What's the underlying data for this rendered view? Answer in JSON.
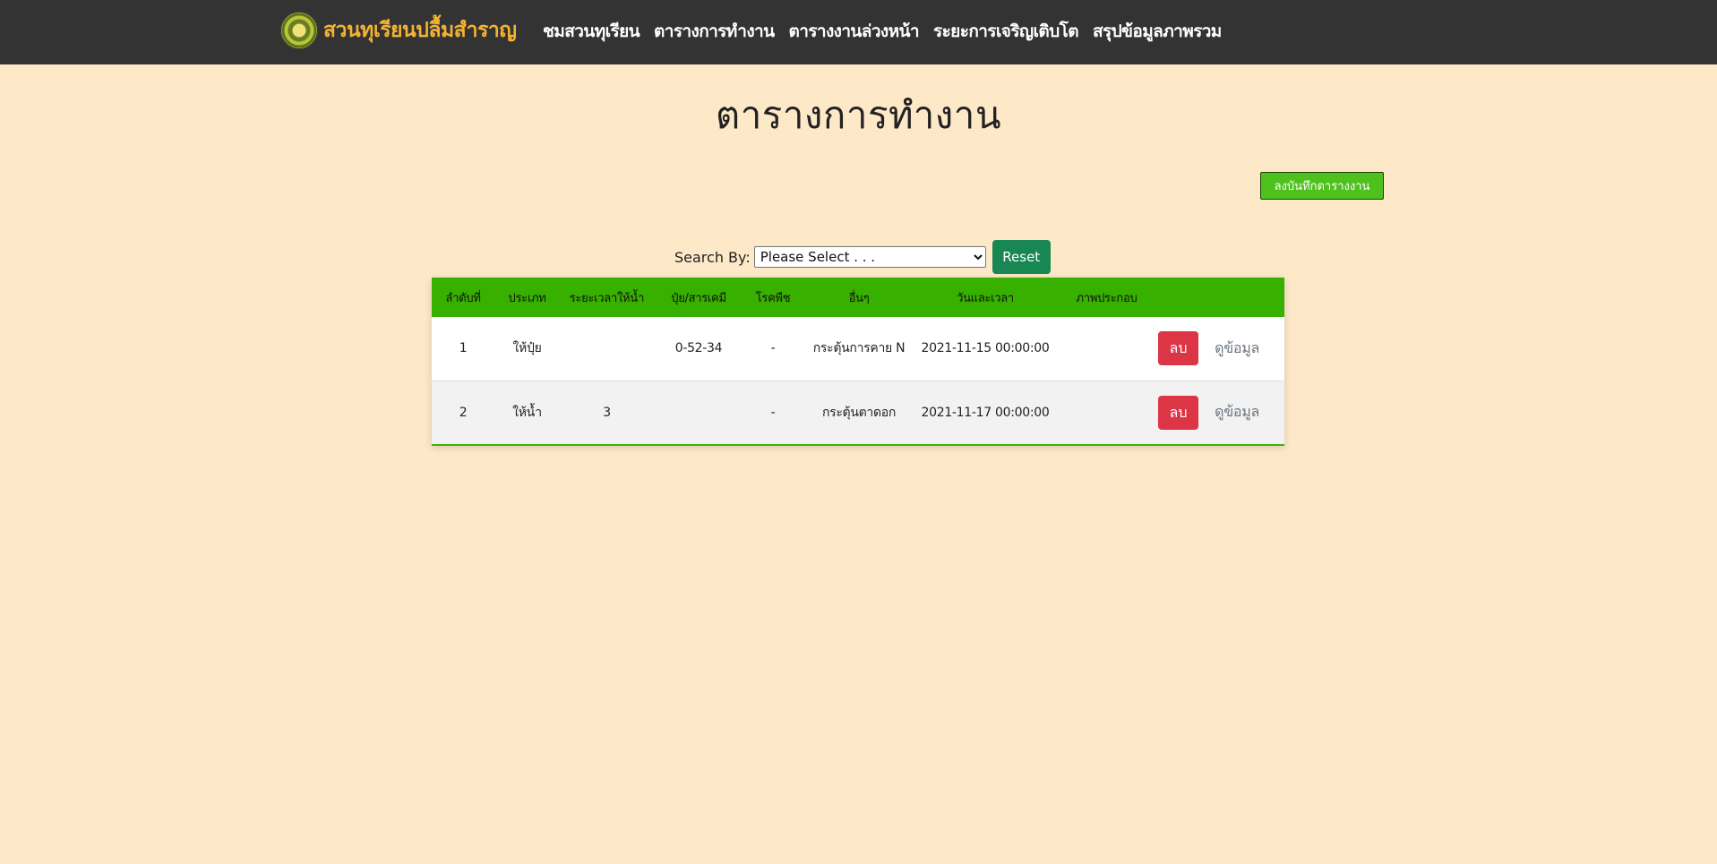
{
  "nav": {
    "brand": "สวนทุเรียนปลื้มสำราญ",
    "links": [
      "ชมสวนทุเรียน",
      "ตารางการทำงาน",
      "ตารางงานล่วงหน้า",
      "ระยะการเจริญเติบโต",
      "สรุปข้อมูลภาพรวม"
    ]
  },
  "page": {
    "title": "ตารางการทำงาน",
    "record_button": "ลงบันทึกตารางงาน"
  },
  "search": {
    "label": "Search By:",
    "selected": "Please Select . . .",
    "reset": "Reset"
  },
  "table": {
    "headers": [
      "ลำดับที่",
      "ประเภท",
      "ระยะเวลาให้น้ำ",
      "ปุ๋ย/สารเคมี",
      "โรคพืช",
      "อื่นๆ",
      "วันและเวลา",
      "ภาพประกอบ",
      ""
    ],
    "rows": [
      {
        "no": "1",
        "type": "ให้ปุ๋ย",
        "water_time": "",
        "fertilizer": "0-52-34",
        "disease": "-",
        "other": "กระตุ้นการคาย N",
        "datetime": "2021-11-15 00:00:00",
        "image": "",
        "delete": "ลบ",
        "view": "ดูข้อมูล"
      },
      {
        "no": "2",
        "type": "ให้น้ำ",
        "water_time": "3",
        "fertilizer": "",
        "disease": "-",
        "other": "กระตุ้นตาดอก",
        "datetime": "2021-11-17 00:00:00",
        "image": "",
        "delete": "ลบ",
        "view": "ดูข้อมูล"
      }
    ]
  },
  "colors": {
    "navbar": "#333333",
    "brand": "#f4b233",
    "background": "#fde9c8",
    "table_header": "#38b000",
    "delete": "#dc3545",
    "reset": "#198754",
    "record": "#4fc11d"
  }
}
